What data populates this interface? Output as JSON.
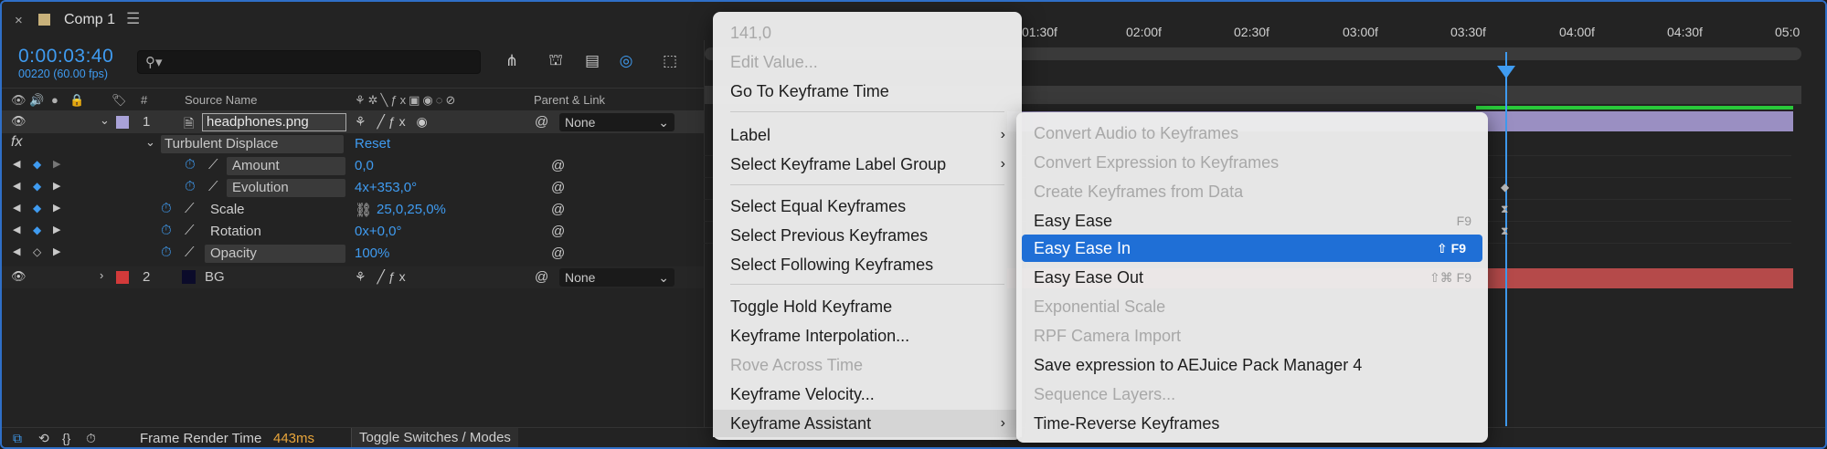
{
  "tab": {
    "close": "×",
    "title": "Comp 1",
    "menu_icon": "☰",
    "swatch_color": "#c8b17a"
  },
  "header": {
    "timecode": "0:00:03:40",
    "fps": "00220 (60.00 fps)",
    "search_placeholder": ""
  },
  "columns": {
    "source_name": "Source Name",
    "parent_link": "Parent & Link",
    "num": "#"
  },
  "layers": [
    {
      "num": "1",
      "name": "headphones.png",
      "parent": "None",
      "color": "#a9a2d8"
    },
    {
      "num": "2",
      "name": "BG",
      "parent": "None",
      "color": "#d23a3a"
    }
  ],
  "effect": {
    "fx": "fx",
    "name": "Turbulent Displace",
    "reset": "Reset"
  },
  "props": [
    {
      "name": "Amount",
      "value": "0,0"
    },
    {
      "name": "Evolution",
      "value": "4x+353,0°"
    },
    {
      "name": "Scale",
      "value": "25,0,25,0%"
    },
    {
      "name": "Rotation",
      "value": "0x+0,0°"
    },
    {
      "name": "Opacity",
      "value": "100%"
    }
  ],
  "status": {
    "label": "Frame Render Time",
    "value": "443ms",
    "toggle": "Toggle Switches / Modes"
  },
  "ruler": [
    "01:30f",
    "02:00f",
    "02:30f",
    "03:00f",
    "03:30f",
    "04:00f",
    "04:30f",
    "05:0"
  ],
  "menu1": {
    "items": [
      {
        "label": "141,0",
        "disabled": true
      },
      {
        "label": "Edit Value...",
        "disabled": true
      },
      {
        "label": "Go To Keyframe Time"
      },
      {
        "label": "Label",
        "submenu": true
      },
      {
        "label": "Select Keyframe Label Group",
        "submenu": true
      },
      {
        "label": "Select Equal Keyframes"
      },
      {
        "label": "Select Previous Keyframes"
      },
      {
        "label": "Select Following Keyframes"
      },
      {
        "label": "Toggle Hold Keyframe"
      },
      {
        "label": "Keyframe Interpolation..."
      },
      {
        "label": "Rove Across Time",
        "disabled": true
      },
      {
        "label": "Keyframe Velocity..."
      },
      {
        "label": "Keyframe Assistant",
        "submenu": true
      }
    ]
  },
  "menu2": {
    "items": [
      {
        "label": "Convert Audio to Keyframes",
        "disabled": true
      },
      {
        "label": "Convert Expression to Keyframes",
        "disabled": true
      },
      {
        "label": "Create Keyframes from Data",
        "disabled": true
      },
      {
        "label": "Easy Ease",
        "shortcut": "F9"
      },
      {
        "label": "Easy Ease In",
        "shortcut": "⇧ F9"
      },
      {
        "label": "Easy Ease Out",
        "shortcut": "⇧⌘ F9"
      },
      {
        "label": "Exponential Scale",
        "disabled": true
      },
      {
        "label": "RPF Camera Import",
        "disabled": true
      },
      {
        "label": "Save expression to AEJuice Pack Manager 4"
      },
      {
        "label": "Sequence Layers...",
        "disabled": true
      },
      {
        "label": "Time-Reverse Keyframes"
      }
    ]
  }
}
